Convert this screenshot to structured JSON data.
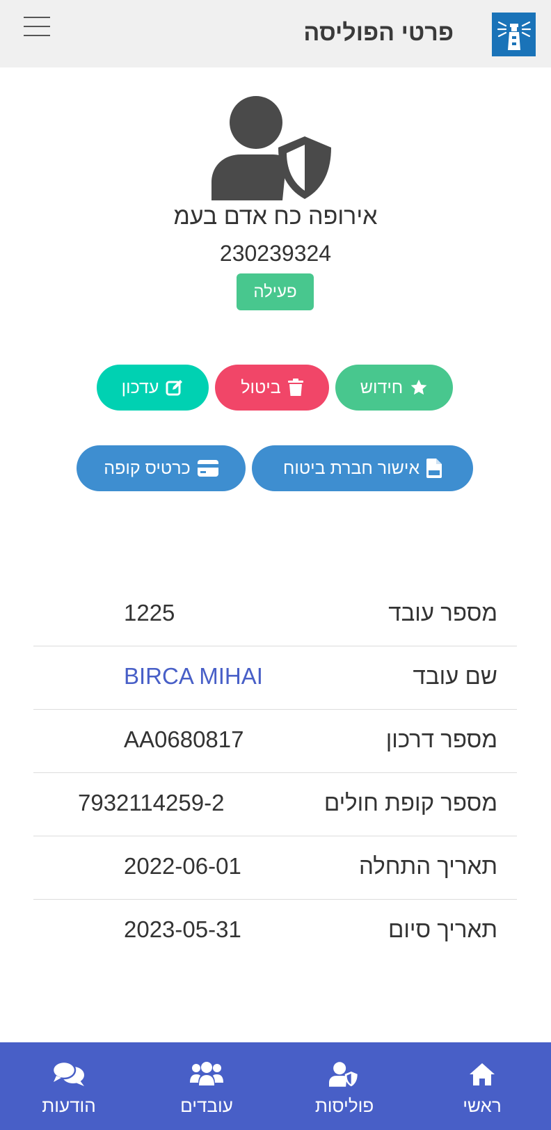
{
  "header": {
    "title": "פרטי הפוליסה",
    "logo_icon": "lighthouse-icon",
    "menu_icon": "hamburger-icon"
  },
  "policy": {
    "avatar_icon": "user-shield-icon",
    "company": "אירופה כח אדם בעמ",
    "number": "230239324",
    "status": "פעילה"
  },
  "actions": {
    "renew": {
      "label": "חידוש",
      "icon": "star-icon"
    },
    "cancel": {
      "label": "ביטול",
      "icon": "trash-icon"
    },
    "update": {
      "label": "עדכון",
      "icon": "edit-icon"
    },
    "insurer_approval": {
      "label": "אישור חברת ביטוח",
      "icon": "pdf-file-icon"
    },
    "fund_card": {
      "label": "כרטיס קופה",
      "icon": "credit-card-icon"
    }
  },
  "details": [
    {
      "label": "מספר עובד",
      "value": "1225"
    },
    {
      "label": "שם עובד",
      "value": "BIRCA MIHAI"
    },
    {
      "label": "מספר דרכון",
      "value": "AA0680817"
    },
    {
      "label": "מספר קופת חולים",
      "value": "7932114259-2"
    },
    {
      "label": "תאריך התחלה",
      "value": "2022-06-01"
    },
    {
      "label": "תאריך סיום",
      "value": "2023-05-31"
    }
  ],
  "nav": [
    {
      "label": "ראשי",
      "icon": "home-icon"
    },
    {
      "label": "פוליסות",
      "icon": "user-shield-icon"
    },
    {
      "label": "עובדים",
      "icon": "users-icon"
    },
    {
      "label": "הודעות",
      "icon": "comments-icon"
    }
  ],
  "colors": {
    "header_bg": "#f0f0f0",
    "success": "#48c78e",
    "danger": "#f14668",
    "primary": "#00d1b2",
    "info": "#3e8ed0",
    "link": "#485fc7",
    "nav_bg": "#485fc7"
  }
}
